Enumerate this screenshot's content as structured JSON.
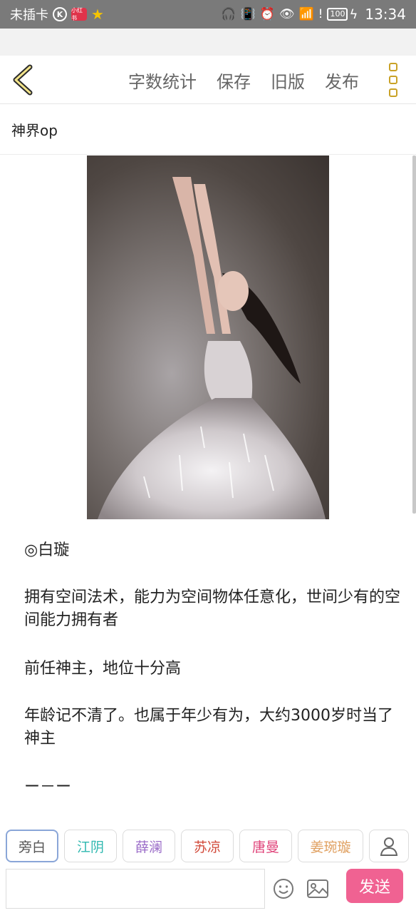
{
  "status_bar": {
    "carrier": "未插卡",
    "badge_k": "K",
    "badge_red": "小红书",
    "battery": "100",
    "time": "13:34"
  },
  "toolbar": {
    "word_count": "字数统计",
    "save": "保存",
    "old_version": "旧版",
    "publish": "发布"
  },
  "document": {
    "title": "神界op"
  },
  "content": {
    "paragraphs": [
      "◎白璇",
      "拥有空间法术，能力为空间物体任意化，世间少有的空间能力拥有者",
      "前任神主，地位十分高",
      "年龄记不清了。也属于年少有为，大约3000岁时当了神主",
      "ー－ー"
    ]
  },
  "roles": [
    {
      "label": "旁白",
      "color": "#555555"
    },
    {
      "label": "江阴",
      "color": "#2fb8b0"
    },
    {
      "label": "薛澜",
      "color": "#9b6dc8"
    },
    {
      "label": "苏凉",
      "color": "#d24a3a"
    },
    {
      "label": "唐曼",
      "color": "#e0457b"
    },
    {
      "label": "姜琬璇",
      "color": "#e0a060"
    }
  ],
  "composer": {
    "input_value": "",
    "send_label": "发送"
  },
  "colors": {
    "accent_gold": "#c9a227",
    "send_pink": "#f06292"
  }
}
